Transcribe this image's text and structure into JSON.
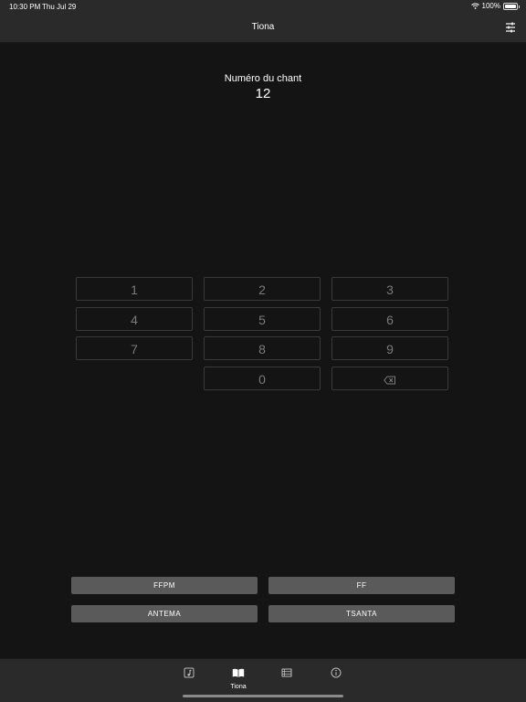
{
  "status": {
    "time": "10:30 PM",
    "date": "Thu Jul 29",
    "battery": "100%"
  },
  "nav": {
    "title": "Tiona"
  },
  "song": {
    "label": "Numéro du chant",
    "number": "12"
  },
  "keypad": [
    "1",
    "2",
    "3",
    "4",
    "5",
    "6",
    "7",
    "8",
    "9",
    "0"
  ],
  "sources": {
    "ffpm": "FFPM",
    "ff": "FF",
    "antema": "ANTEMA",
    "tsanta": "TSANTA"
  },
  "tabbar": {
    "active_label": "Tiona",
    "active_index": 1
  },
  "colors": {
    "background": "#141414",
    "bar": "#2a2a2a",
    "button": "#5a5a5a",
    "key_text": "#7a7a7a"
  }
}
